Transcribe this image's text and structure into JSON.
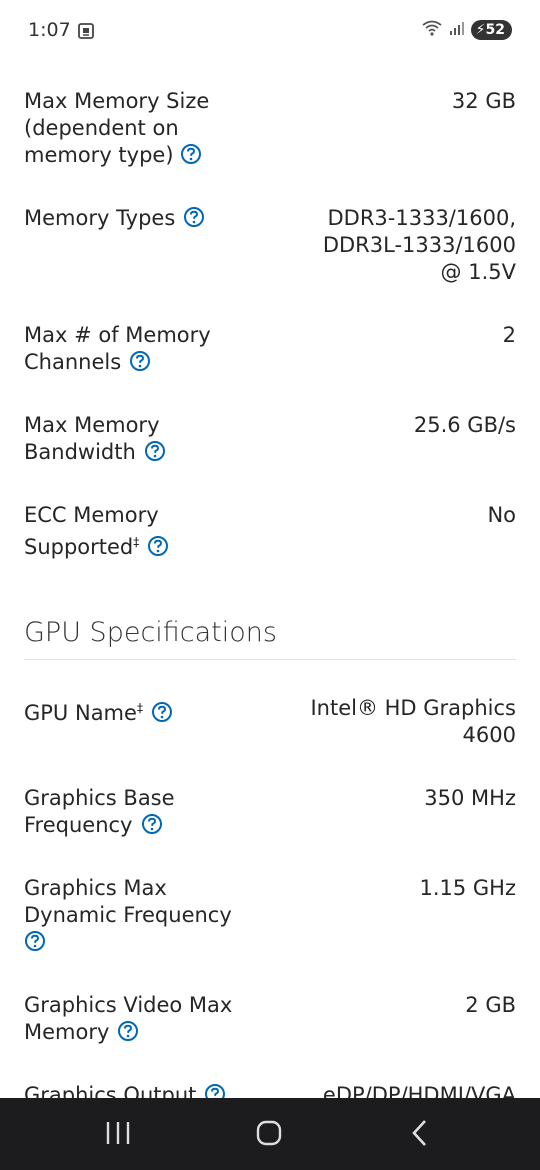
{
  "status_bar": {
    "time": "1:07",
    "battery": "52"
  },
  "memory_specs": [
    {
      "label": "Max Memory Size (dependent on memory type)",
      "value": "32 GB"
    },
    {
      "label": "Memory Types",
      "value": "DDR3-1333/1600, DDR3L-1333/1600 @ 1.5V"
    },
    {
      "label": "Max # of Memory Channels",
      "value": "2"
    },
    {
      "label": "Max Memory Bandwidth",
      "value": "25.6 GB/s"
    },
    {
      "label": "ECC Memory Supported",
      "value": "No"
    }
  ],
  "gpu_section_title": "GPU Specifications",
  "gpu_specs": [
    {
      "label": "GPU Name",
      "value": "Intel® HD Graphics 4600"
    },
    {
      "label": "Graphics Base Frequency",
      "value": "350 MHz"
    },
    {
      "label": "Graphics Max Dynamic Frequency",
      "value": "1.15 GHz"
    },
    {
      "label": "Graphics Video Max Memory",
      "value": "2 GB"
    },
    {
      "label": "Graphics Output",
      "value": "eDP/DP/HDMI/VGA"
    }
  ],
  "footnote_mark": "‡",
  "icons": {
    "help": "help-circle-icon",
    "status_screen": "screenshot-icon",
    "wifi": "wifi-icon",
    "signal": "signal-icon",
    "battery": "battery-icon",
    "nav_recents": "recents-icon",
    "nav_home": "home-icon",
    "nav_back": "back-icon"
  },
  "colors": {
    "help_icon": "#0068b5",
    "nav_bar": "#1c1c1e",
    "text": "#262626"
  }
}
